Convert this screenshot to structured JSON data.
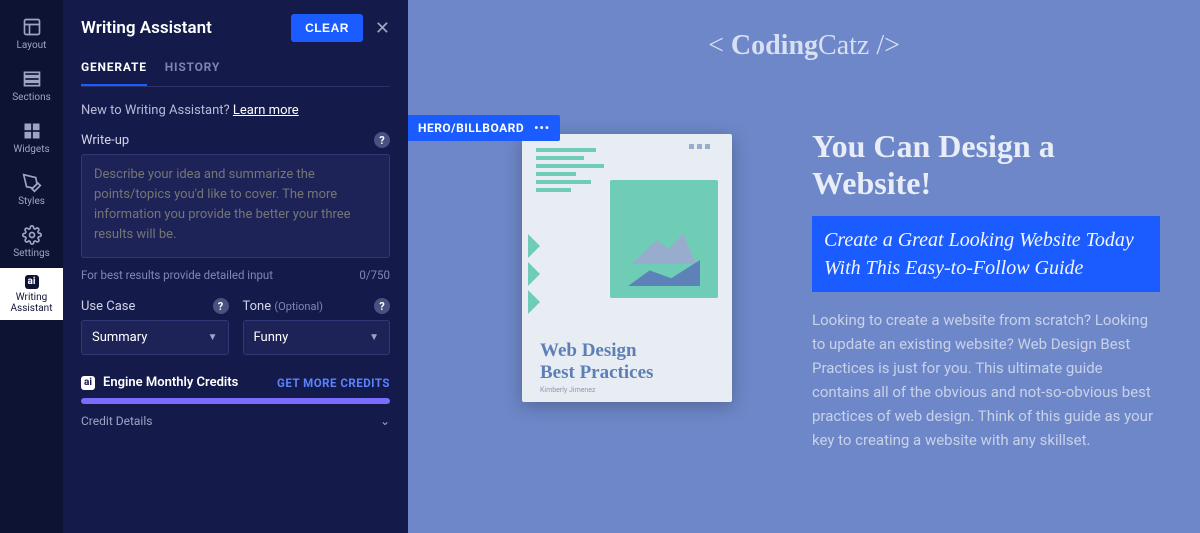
{
  "rail": {
    "items": [
      {
        "label": "Layout",
        "icon": "layout-icon"
      },
      {
        "label": "Sections",
        "icon": "sections-icon"
      },
      {
        "label": "Widgets",
        "icon": "widgets-icon"
      },
      {
        "label": "Styles",
        "icon": "styles-icon"
      },
      {
        "label": "Settings",
        "icon": "settings-icon"
      },
      {
        "label": "Writing Assistant",
        "icon": "ai-icon",
        "active": true
      }
    ]
  },
  "panel": {
    "title": "Writing Assistant",
    "clear": "CLEAR",
    "tabs": {
      "generate": "GENERATE",
      "history": "HISTORY"
    },
    "tip_prefix": "New to Writing Assistant? ",
    "tip_link": "Learn more",
    "writeup_label": "Write-up",
    "writeup_placeholder": "Describe your idea and summarize the points/topics you'd like to cover. The more information you provide the better your three results will be.",
    "helper_text": "For best results provide detailed input",
    "char_count": "0/750",
    "usecase_label": "Use Case",
    "usecase_value": "Summary",
    "tone_label": "Tone",
    "tone_optional": "(Optional)",
    "tone_value": "Funny",
    "credits_label": "Engine Monthly Credits",
    "get_more": "GET MORE CREDITS",
    "credit_details": "Credit Details",
    "ai_badge": "ai"
  },
  "canvas": {
    "brand_prefix": "< ",
    "brand_bold": "Coding",
    "brand_light": "Catz />",
    "section_tag": "HERO/BILLBOARD",
    "book_title_l1": "Web Design",
    "book_title_l2": "Best Practices",
    "book_author": "Kimberly Jimenez",
    "hero_h1": "You Can Design a Website!",
    "hero_sub": "Create a Great Looking Website Today With This Easy-to-Follow Guide",
    "hero_body": "Looking to create a website from scratch? Looking to update an existing website? Web Design Best Practices is just for you. This ultimate guide contains all of the obvious and not-so-obvious best practices of web design. Think of this guide as your key to creating a website with any skillset."
  }
}
